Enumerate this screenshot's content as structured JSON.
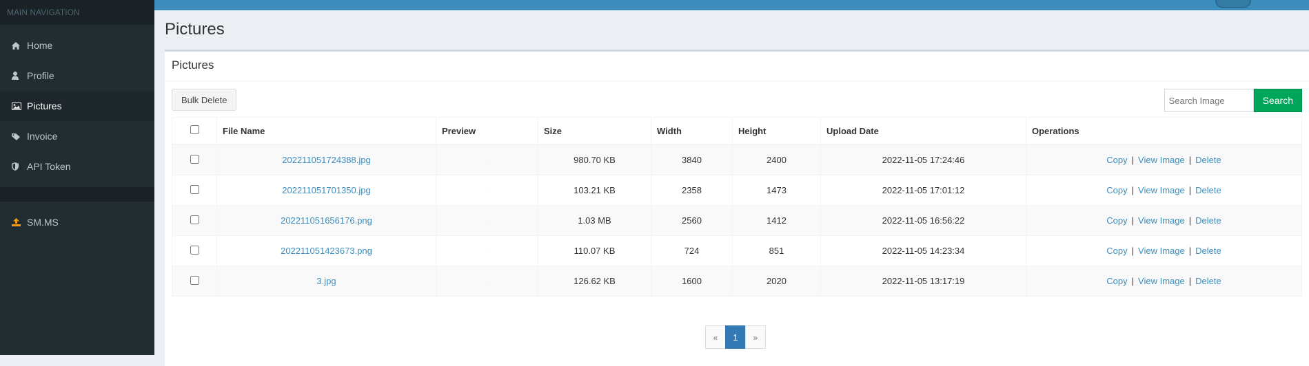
{
  "sidebar": {
    "header": "MAIN NAVIGATION",
    "items": [
      {
        "label": "Home",
        "icon": "home-icon"
      },
      {
        "label": "Profile",
        "icon": "user-icon"
      },
      {
        "label": "Pictures",
        "icon": "picture-icon",
        "active": true
      },
      {
        "label": "Invoice",
        "icon": "tag-icon"
      },
      {
        "label": "API Token",
        "icon": "shield-icon"
      }
    ],
    "external": {
      "label": "SM.MS",
      "icon": "upload-icon",
      "icon_color": "#f39c12"
    }
  },
  "page": {
    "title": "Pictures"
  },
  "box": {
    "title": "Pictures"
  },
  "toolbar": {
    "bulk_delete_label": "Bulk Delete",
    "search_placeholder": "Search Image",
    "search_label": "Search"
  },
  "table": {
    "headers": [
      "File Name",
      "Preview",
      "Size",
      "Width",
      "Height",
      "Upload Date",
      "Operations"
    ],
    "ops": {
      "copy": "Copy",
      "view": "View Image",
      "delete": "Delete",
      "separator": "|"
    },
    "rows": [
      {
        "file": "202211051724388.jpg",
        "preview": "·",
        "size": "980.70 KB",
        "width": "3840",
        "height": "2400",
        "date": "2022-11-05 17:24:46"
      },
      {
        "file": "202211051701350.jpg",
        "preview": "·",
        "size": "103.21 KB",
        "width": "2358",
        "height": "1473",
        "date": "2022-11-05 17:01:12"
      },
      {
        "file": "202211051656176.png",
        "preview": "·",
        "size": "1.03 MB",
        "width": "2560",
        "height": "1412",
        "date": "2022-11-05 16:56:22"
      },
      {
        "file": "202211051423673.png",
        "preview": "·",
        "size": "110.07 KB",
        "width": "724",
        "height": "851",
        "date": "2022-11-05 14:23:34"
      },
      {
        "file": "3.jpg",
        "preview": "·",
        "size": "126.62 KB",
        "width": "1600",
        "height": "2020",
        "date": "2022-11-05 13:17:19"
      }
    ]
  },
  "pagination": {
    "prev": "«",
    "current": "1",
    "next": "»"
  },
  "colors": {
    "topbar": "#3c8dbc",
    "sidebar": "#222d32",
    "search_button": "#00a65a",
    "link": "#3c8dbc"
  }
}
